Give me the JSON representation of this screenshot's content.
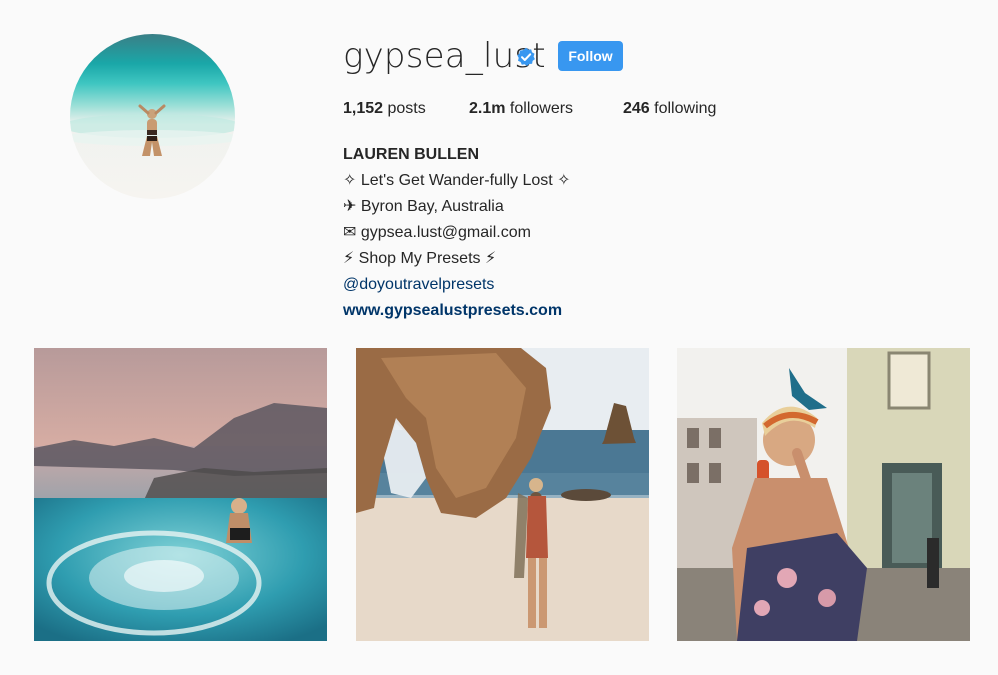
{
  "profile": {
    "username": "gypsea_lust",
    "verified_icon": "verified-badge-icon",
    "follow_label": "Follow",
    "avatar_alt": "profile-photo"
  },
  "stats": {
    "posts_count": "1,152",
    "posts_label": "posts",
    "followers_count": "2.1m",
    "followers_label": "followers",
    "following_count": "246",
    "following_label": "following"
  },
  "bio": {
    "full_name": "LAUREN BULLEN",
    "line1": "✧ Let's Get Wander-fully Lost ✧",
    "line2": "✈ Byron Bay, Australia",
    "line3": "✉ gypsea.lust@gmail.com",
    "line4": "⚡ Shop My Presets ⚡",
    "mention": "@doyoutravelpresets",
    "website": "www.gypsealustpresets.com"
  },
  "colors": {
    "background": "#fafafa",
    "follow_button": "#3897f0",
    "link": "#003569",
    "verified": "#3897f0"
  }
}
